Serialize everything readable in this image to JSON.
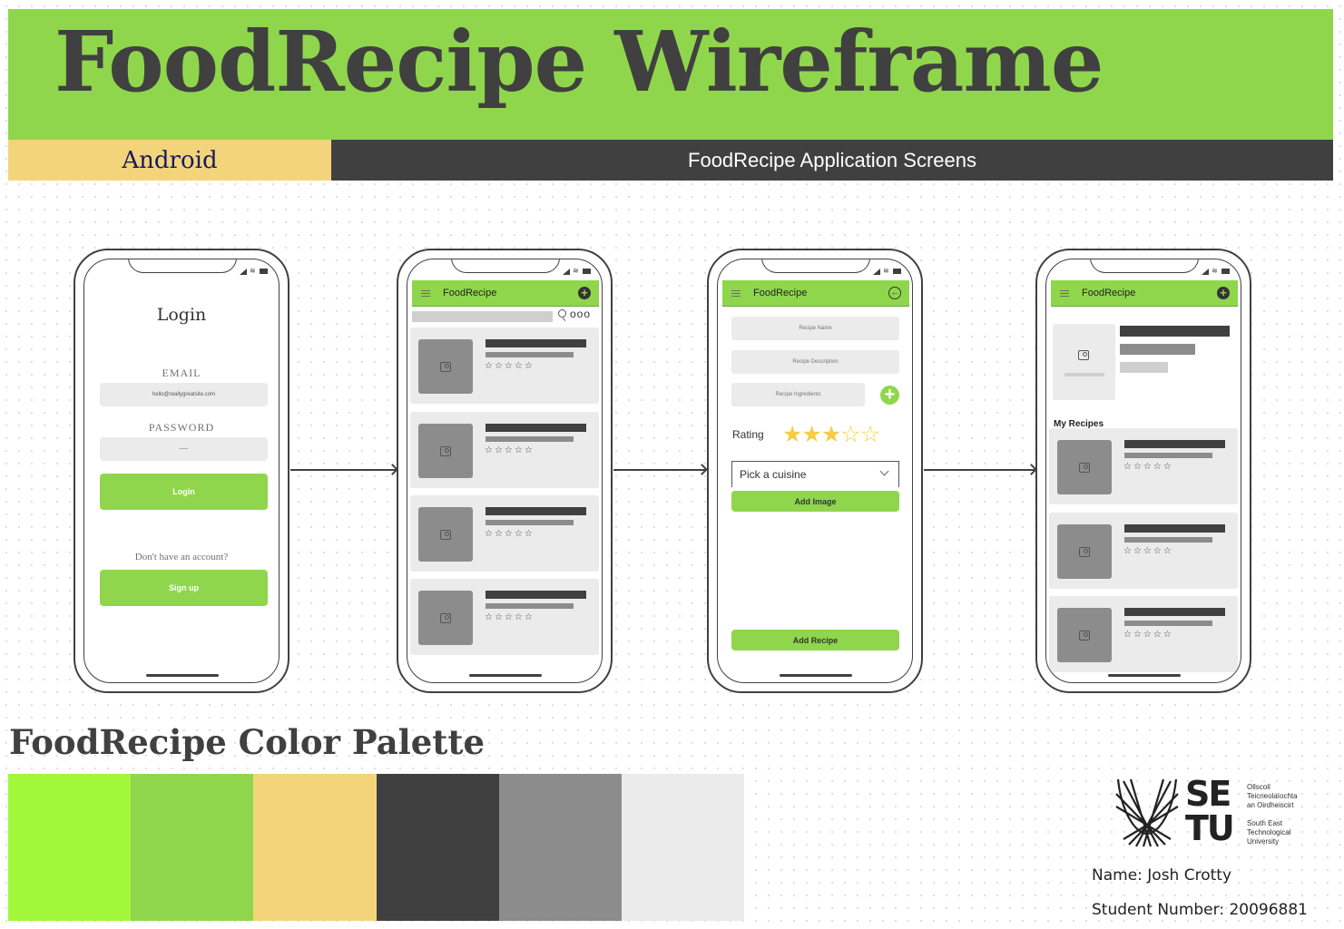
{
  "header": {
    "title": "FoodRecipe Wireframe",
    "platform": "Android",
    "subtitle": "FoodRecipe Application Screens"
  },
  "screens": {
    "login": {
      "title": "Login",
      "email_label": "EMAIL",
      "email_value": "hello@reallygreatsite.com",
      "password_label": "PASSWORD",
      "password_value": "-----",
      "login_button": "Login",
      "no_account_text": "Don't have an account?",
      "signup_button": "Sign up"
    },
    "recipe_list": {
      "app_title": "FoodRecipe",
      "more_label": "ooo",
      "card_count": 4,
      "stars": "☆☆☆☆☆"
    },
    "add_recipe": {
      "app_title": "FoodRecipe",
      "recipe_name_placeholder": "Recipe Name",
      "recipe_description_placeholder": "Recipe Description",
      "recipe_ingredients_placeholder": "Recipe Ingredients",
      "rating_label": "Rating",
      "rating_value": 3,
      "rating_max": 5,
      "cuisine_select": "Pick a cuisine",
      "add_image_button": "Add Image",
      "add_recipe_button": "Add Recipe"
    },
    "profile": {
      "app_title": "FoodRecipe",
      "section_title": "My Recipes",
      "card_count": 3,
      "stars": "☆☆☆☆☆"
    }
  },
  "palette": {
    "title": "FoodRecipe Color Palette",
    "colors": [
      "#a2f73b",
      "#8fd64c",
      "#f4d47b",
      "#404040",
      "#8c8c8c",
      "#ebebeb"
    ]
  },
  "logo": {
    "letters_top": "SE",
    "letters_bottom": "TU",
    "irish_lines": [
      "Ollscoil",
      "Teicneolaíochta",
      "an Oirdheiscirt"
    ],
    "english_lines": [
      "South East",
      "Technological",
      "University"
    ]
  },
  "student": {
    "name": "Name: Josh Crotty",
    "number": "Student Number: 20096881"
  }
}
